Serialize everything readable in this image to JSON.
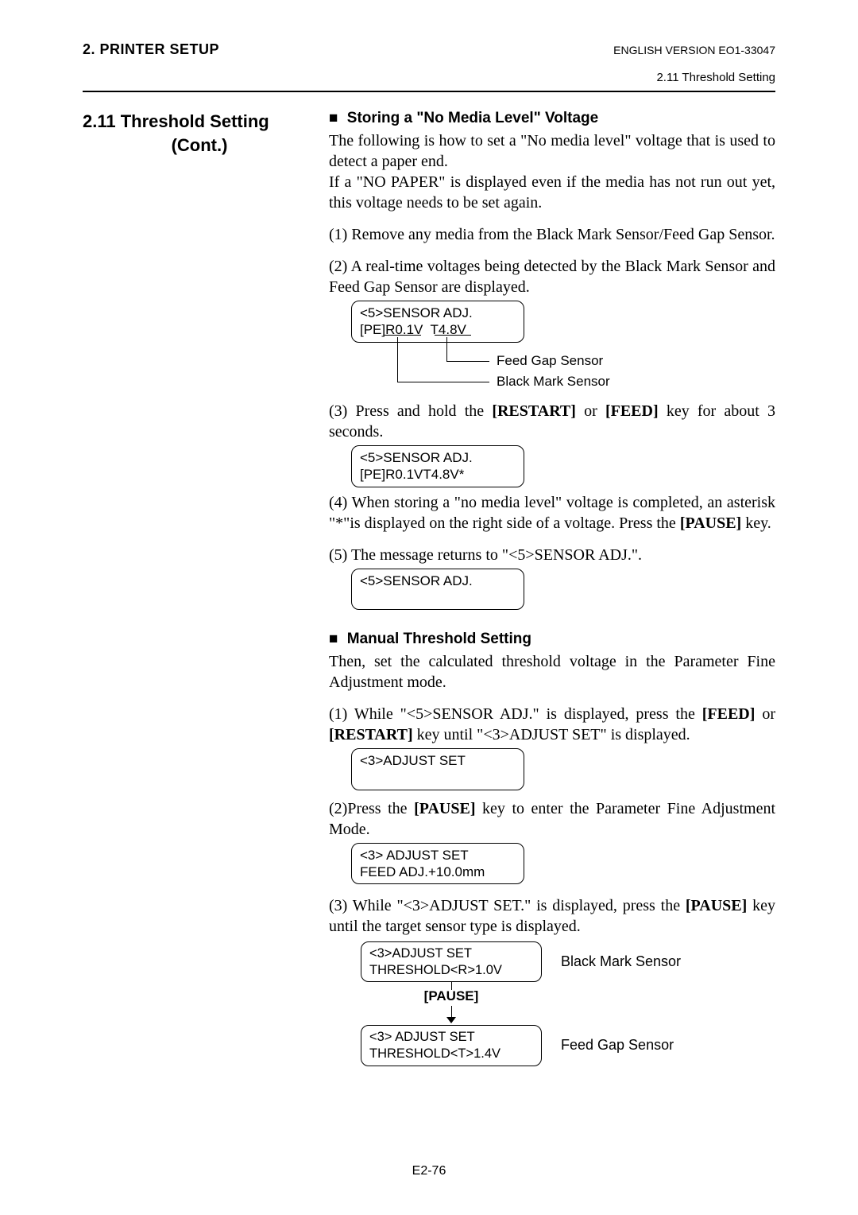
{
  "header": {
    "left": "2. PRINTER SETUP",
    "right": "ENGLISH VERSION EO1-33047",
    "sub": "2.11 Threshold Setting"
  },
  "leftcol": {
    "title_line1": "2.11  Threshold Setting",
    "title_line2": "(Cont.)"
  },
  "sec1": {
    "bullet": "■",
    "heading": "Storing a \"No Media Level\" Voltage",
    "p1": "The following is how to set a \"No media level\" voltage that is used to detect a paper end.",
    "p2": "If a \"NO PAPER\" is displayed even if the media has not run out yet, this voltage needs to be set again.",
    "step1": "(1) Remove any media from the Black Mark Sensor/Feed Gap Sensor.",
    "step2": "(2) A real-time voltages being detected by the Black Mark Sensor and Feed Gap Sensor are displayed.",
    "lcd2_line1": "<5>SENSOR ADJ.",
    "lcd2_line2": "[PE]R0.1V  T4.8V",
    "diag_label1": "Feed Gap Sensor",
    "diag_label2": "Black Mark Sensor",
    "step3_pre": "(3) Press and hold the ",
    "step3_key1": "[RESTART]",
    "step3_mid": " or ",
    "step3_key2": "[FEED]",
    "step3_post": " key for about 3 seconds.",
    "lcd3_line1": "<5>SENSOR ADJ.",
    "lcd3_line2": "[PE]R0.1VT4.8V*",
    "step4_pre": "(4) When storing a \"no media level\" voltage is completed, an asterisk \"*\"is displayed on the right side of a voltage.  Press the ",
    "step4_key": "[PAUSE]",
    "step4_post": " key.",
    "step5": "(5) The message returns to \"<5>SENSOR ADJ.\".",
    "lcd5_line1": "<5>SENSOR ADJ.",
    "lcd5_line2": " "
  },
  "sec2": {
    "bullet": "■",
    "heading": "Manual Threshold Setting",
    "p1": "Then, set the calculated threshold voltage in the Parameter Fine Adjustment mode.",
    "step1_pre": "(1) While \"<5>SENSOR ADJ.\" is displayed, press the ",
    "step1_key1": "[FEED]",
    "step1_mid": " or ",
    "step1_key2": "[RESTART]",
    "step1_post": " key until \"<3>ADJUST SET\" is displayed.",
    "lcd1_line1": "<3>ADJUST SET",
    "lcd1_line2": " ",
    "step2_pre": "(2)Press the ",
    "step2_key": "[PAUSE]",
    "step2_post": " key to enter the Parameter Fine Adjustment Mode.",
    "lcd2_line1": "<3> ADJUST SET",
    "lcd2_line2": "FEED ADJ.+10.0mm",
    "step3_pre": "(3) While \"<3>ADJUST SET.\" is displayed, press the ",
    "step3_key": "[PAUSE]",
    "step3_post": " key until the target sensor type is displayed.",
    "flow_lcdA_line1": "<3>ADJUST SET",
    "flow_lcdA_line2": "THRESHOLD<R>1.0V",
    "flow_labelA": "Black Mark Sensor",
    "flow_pause": "[PAUSE]",
    "flow_lcdB_line1": "<3> ADJUST SET",
    "flow_lcdB_line2": "THRESHOLD<T>1.4V",
    "flow_labelB": "Feed Gap Sensor"
  },
  "footer": "E2-76"
}
